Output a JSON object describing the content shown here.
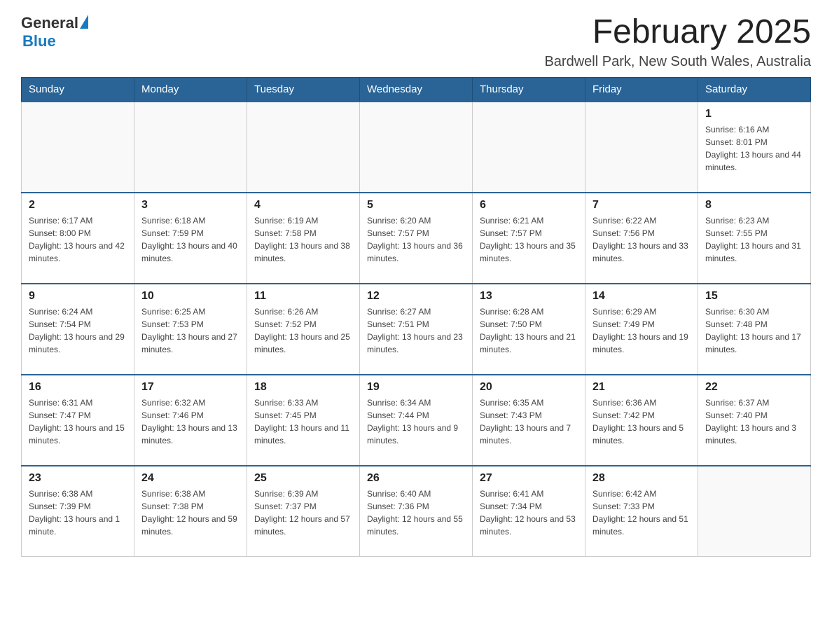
{
  "header": {
    "logo": {
      "general": "General",
      "blue": "Blue",
      "tagline": "GeneralBlue"
    },
    "title": "February 2025",
    "location": "Bardwell Park, New South Wales, Australia"
  },
  "days_of_week": [
    "Sunday",
    "Monday",
    "Tuesday",
    "Wednesday",
    "Thursday",
    "Friday",
    "Saturday"
  ],
  "weeks": [
    {
      "days": [
        {
          "number": "",
          "info": ""
        },
        {
          "number": "",
          "info": ""
        },
        {
          "number": "",
          "info": ""
        },
        {
          "number": "",
          "info": ""
        },
        {
          "number": "",
          "info": ""
        },
        {
          "number": "",
          "info": ""
        },
        {
          "number": "1",
          "info": "Sunrise: 6:16 AM\nSunset: 8:01 PM\nDaylight: 13 hours and 44 minutes."
        }
      ]
    },
    {
      "days": [
        {
          "number": "2",
          "info": "Sunrise: 6:17 AM\nSunset: 8:00 PM\nDaylight: 13 hours and 42 minutes."
        },
        {
          "number": "3",
          "info": "Sunrise: 6:18 AM\nSunset: 7:59 PM\nDaylight: 13 hours and 40 minutes."
        },
        {
          "number": "4",
          "info": "Sunrise: 6:19 AM\nSunset: 7:58 PM\nDaylight: 13 hours and 38 minutes."
        },
        {
          "number": "5",
          "info": "Sunrise: 6:20 AM\nSunset: 7:57 PM\nDaylight: 13 hours and 36 minutes."
        },
        {
          "number": "6",
          "info": "Sunrise: 6:21 AM\nSunset: 7:57 PM\nDaylight: 13 hours and 35 minutes."
        },
        {
          "number": "7",
          "info": "Sunrise: 6:22 AM\nSunset: 7:56 PM\nDaylight: 13 hours and 33 minutes."
        },
        {
          "number": "8",
          "info": "Sunrise: 6:23 AM\nSunset: 7:55 PM\nDaylight: 13 hours and 31 minutes."
        }
      ]
    },
    {
      "days": [
        {
          "number": "9",
          "info": "Sunrise: 6:24 AM\nSunset: 7:54 PM\nDaylight: 13 hours and 29 minutes."
        },
        {
          "number": "10",
          "info": "Sunrise: 6:25 AM\nSunset: 7:53 PM\nDaylight: 13 hours and 27 minutes."
        },
        {
          "number": "11",
          "info": "Sunrise: 6:26 AM\nSunset: 7:52 PM\nDaylight: 13 hours and 25 minutes."
        },
        {
          "number": "12",
          "info": "Sunrise: 6:27 AM\nSunset: 7:51 PM\nDaylight: 13 hours and 23 minutes."
        },
        {
          "number": "13",
          "info": "Sunrise: 6:28 AM\nSunset: 7:50 PM\nDaylight: 13 hours and 21 minutes."
        },
        {
          "number": "14",
          "info": "Sunrise: 6:29 AM\nSunset: 7:49 PM\nDaylight: 13 hours and 19 minutes."
        },
        {
          "number": "15",
          "info": "Sunrise: 6:30 AM\nSunset: 7:48 PM\nDaylight: 13 hours and 17 minutes."
        }
      ]
    },
    {
      "days": [
        {
          "number": "16",
          "info": "Sunrise: 6:31 AM\nSunset: 7:47 PM\nDaylight: 13 hours and 15 minutes."
        },
        {
          "number": "17",
          "info": "Sunrise: 6:32 AM\nSunset: 7:46 PM\nDaylight: 13 hours and 13 minutes."
        },
        {
          "number": "18",
          "info": "Sunrise: 6:33 AM\nSunset: 7:45 PM\nDaylight: 13 hours and 11 minutes."
        },
        {
          "number": "19",
          "info": "Sunrise: 6:34 AM\nSunset: 7:44 PM\nDaylight: 13 hours and 9 minutes."
        },
        {
          "number": "20",
          "info": "Sunrise: 6:35 AM\nSunset: 7:43 PM\nDaylight: 13 hours and 7 minutes."
        },
        {
          "number": "21",
          "info": "Sunrise: 6:36 AM\nSunset: 7:42 PM\nDaylight: 13 hours and 5 minutes."
        },
        {
          "number": "22",
          "info": "Sunrise: 6:37 AM\nSunset: 7:40 PM\nDaylight: 13 hours and 3 minutes."
        }
      ]
    },
    {
      "days": [
        {
          "number": "23",
          "info": "Sunrise: 6:38 AM\nSunset: 7:39 PM\nDaylight: 13 hours and 1 minute."
        },
        {
          "number": "24",
          "info": "Sunrise: 6:38 AM\nSunset: 7:38 PM\nDaylight: 12 hours and 59 minutes."
        },
        {
          "number": "25",
          "info": "Sunrise: 6:39 AM\nSunset: 7:37 PM\nDaylight: 12 hours and 57 minutes."
        },
        {
          "number": "26",
          "info": "Sunrise: 6:40 AM\nSunset: 7:36 PM\nDaylight: 12 hours and 55 minutes."
        },
        {
          "number": "27",
          "info": "Sunrise: 6:41 AM\nSunset: 7:34 PM\nDaylight: 12 hours and 53 minutes."
        },
        {
          "number": "28",
          "info": "Sunrise: 6:42 AM\nSunset: 7:33 PM\nDaylight: 12 hours and 51 minutes."
        },
        {
          "number": "",
          "info": ""
        }
      ]
    }
  ]
}
